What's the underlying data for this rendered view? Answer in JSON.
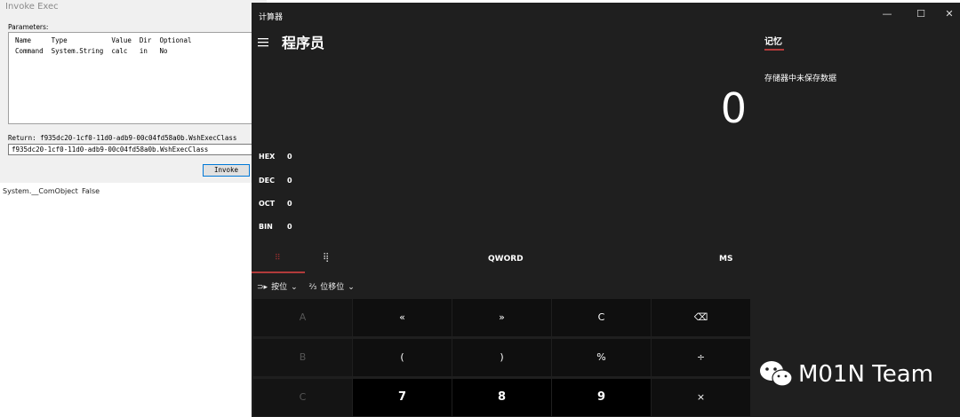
{
  "invoke_dialog": {
    "title": "Invoke Exec",
    "parameters_label": "Parameters:",
    "columns": [
      "Name",
      "Type",
      "Value",
      "Dir",
      "Optional"
    ],
    "rows": [
      [
        "Command",
        "System.String",
        "calc",
        "in",
        "No"
      ]
    ],
    "return_label": "Return:  f935dc20-1cf0-11d0-adb9-00c04fd58a0b.WshExecClass",
    "return_value": "f935dc20-1cf0-11d0-adb9-00c04fd58a0b.WshExecClass",
    "invoke_button": "Invoke"
  },
  "background_list": {
    "rows": [
      {
        "name": "System.__ComObject",
        "value": "False"
      }
    ]
  },
  "calculator": {
    "app_title": "计算器",
    "window_controls": {
      "minimize": "—",
      "maximize": "☐",
      "close": "✕"
    },
    "mode_title": "程序员",
    "display_value": "0",
    "bases": [
      {
        "label": "HEX",
        "value": "0"
      },
      {
        "label": "DEC",
        "value": "0"
      },
      {
        "label": "OCT",
        "value": "0"
      },
      {
        "label": "BIN",
        "value": "0"
      }
    ],
    "word_size": "QWORD",
    "memory_store": "MS",
    "bitwise_label": "按位",
    "bitshift_label": "位移位",
    "keys_row1": [
      "A",
      "«",
      "»",
      "C",
      "⌫"
    ],
    "keys_row2": [
      "B",
      "(",
      ")",
      "%",
      "÷"
    ],
    "keys_row3": [
      "C",
      "7",
      "8",
      "9",
      "×"
    ],
    "memory_tab": "记忆",
    "memory_empty": "存储器中未保存数据",
    "accent_color": "#b23b3b"
  },
  "watermark": {
    "text": "M01N Team",
    "icon": "wechat-icon"
  }
}
